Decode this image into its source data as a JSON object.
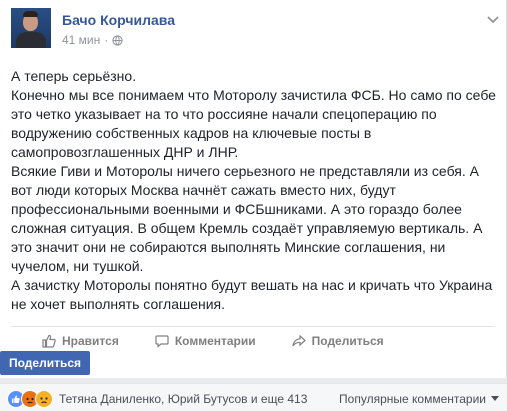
{
  "post": {
    "author": "Бачо Корчилава",
    "time": "41 мин",
    "separator": "·",
    "paragraphs": [
      "А теперь серьёзно.",
      "Конечно мы все понимаем что Моторолу зачистила ФСБ. Но само по себе это четко указывает на то что россияне начали спецоперацию по водружению собственных кадров на ключевые посты в самопровозглашенных ДНР и ЛНР.",
      "Всякие Гиви и Моторолы ничего серьезного не представляли из себя. А вот люди которых Москва начнёт сажать вместо них, будут профессиональными военными и ФСБшниками. А это гораздо более сложная ситуация. В общем Кремль создаёт управляемую вертикаль. А это значит они не собираются выполнять Минские соглашения, ни чучелом, ни тушкой.",
      "А зачистку Моторолы понятно будут вешать на нас и кричать что Украина не хочет выполнять соглашения."
    ]
  },
  "actions": {
    "like": "Нравится",
    "comment": "Комментарии",
    "share": "Поделиться"
  },
  "share_button": "Поделиться",
  "reactions": {
    "names": "Тетяна Даниленко, Юрий Бутусов и еще 413",
    "sort_label": "Популярные комментарии"
  },
  "colors": {
    "link": "#365899",
    "button": "#4267b2",
    "meta": "#90949c"
  },
  "icons": [
    "globe-icon",
    "chevron-down-icon",
    "like-icon",
    "comment-icon",
    "share-icon",
    "like-reaction-icon",
    "angry-reaction-icon",
    "sad-reaction-icon",
    "dropdown-arrow-icon"
  ]
}
